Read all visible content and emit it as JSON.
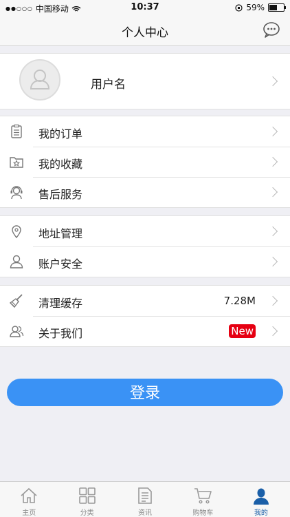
{
  "status_bar": {
    "carrier": "中国移动",
    "time": "10:37",
    "battery": "59%",
    "battery_level": 0.59
  },
  "nav": {
    "title": "个人中心",
    "message_icon": "chat-bubble-icon"
  },
  "profile": {
    "username": "用户名",
    "avatar_icon": "default-avatar-icon"
  },
  "groups": [
    [
      {
        "label": "我的订单",
        "icon": "clipboard-icon"
      },
      {
        "label": "我的收藏",
        "icon": "star-folder-icon"
      },
      {
        "label": "售后服务",
        "icon": "headset-icon"
      }
    ],
    [
      {
        "label": "地址管理",
        "icon": "location-pin-icon"
      },
      {
        "label": "账户安全",
        "icon": "user-icon"
      }
    ],
    [
      {
        "label": "清理缓存",
        "icon": "broom-icon",
        "value": "7.28M"
      },
      {
        "label": "关于我们",
        "icon": "users-icon",
        "badge": "New"
      }
    ]
  ],
  "login_button": "登录",
  "tabbar": [
    {
      "label": "主页",
      "icon": "home-icon"
    },
    {
      "label": "分类",
      "icon": "grid-icon"
    },
    {
      "label": "资讯",
      "icon": "news-icon"
    },
    {
      "label": "购物车",
      "icon": "cart-icon"
    },
    {
      "label": "我的",
      "icon": "profile-icon",
      "active": true
    }
  ],
  "colors": {
    "accent": "#3a92f5",
    "badge": "#e60012",
    "tab_active": "#1a5fa8"
  }
}
